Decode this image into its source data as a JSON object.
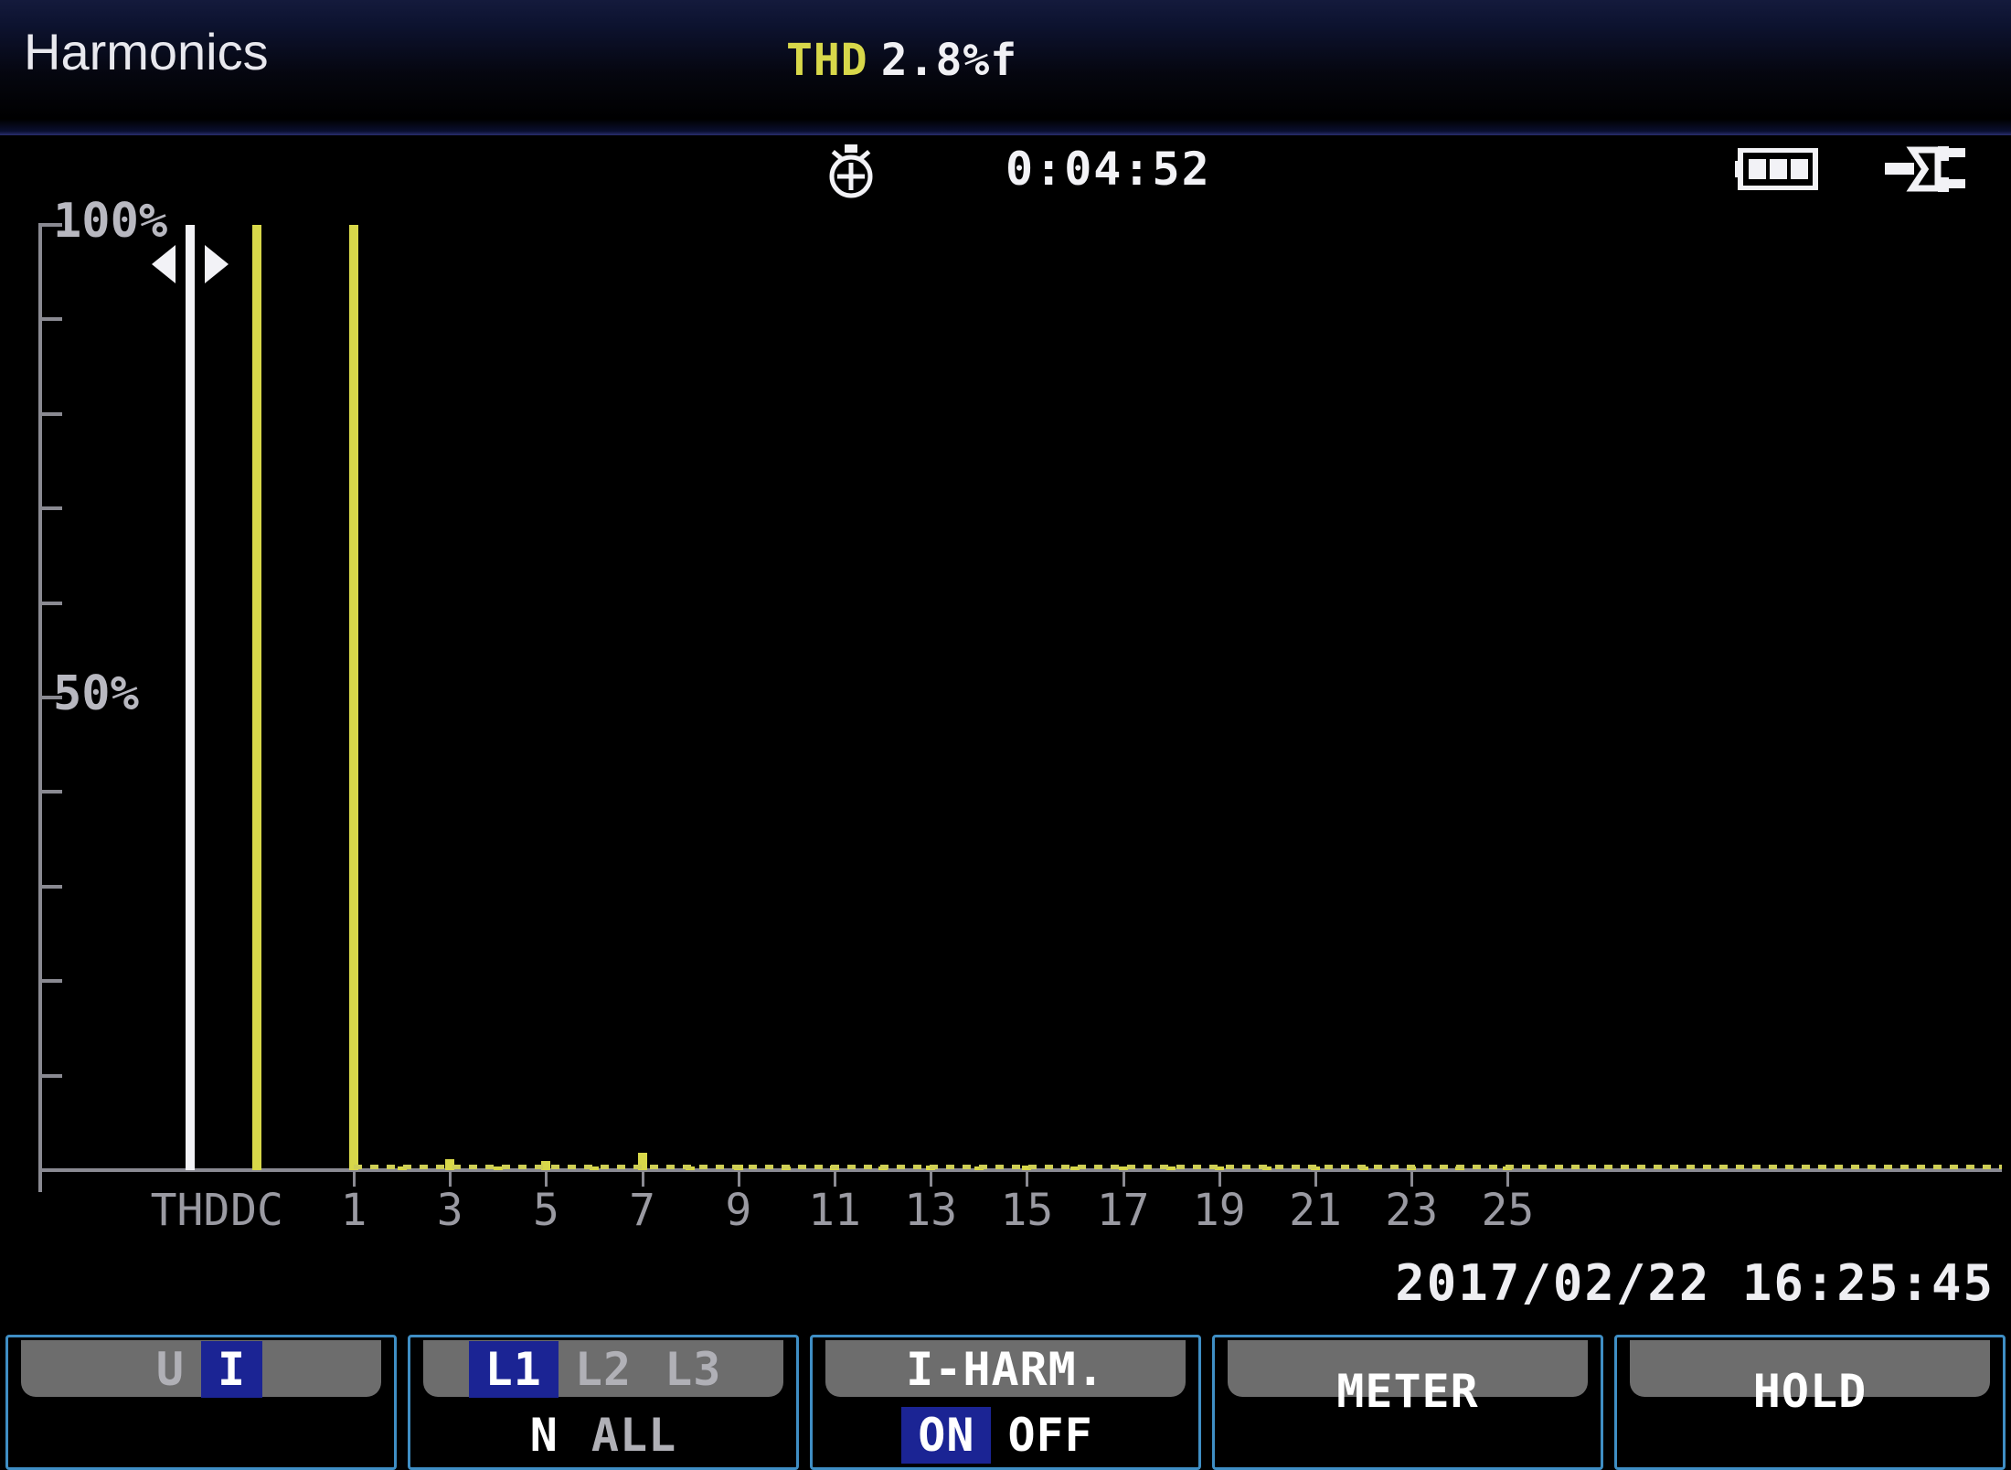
{
  "header": {
    "title": "Harmonics",
    "thd_label": "THD",
    "thd_value": "2.8%f",
    "thd_color": "#d8d84a"
  },
  "status": {
    "timer_icon": "stopwatch-icon",
    "timer": "0:04:52",
    "battery_icon": "battery-full-icon",
    "battery_bars": 3,
    "power_icon": "power-plug-icon"
  },
  "chart_data": {
    "type": "bar",
    "title": "Harmonics",
    "xlabel": "",
    "ylabel": "%",
    "ylim": [
      0,
      110
    ],
    "grid": false,
    "legend": "none",
    "ytick_labels": [
      "100%",
      "50%"
    ],
    "ytick_values": [
      100,
      50
    ],
    "yticks_minor": [
      90,
      80,
      70,
      60,
      40,
      30,
      20,
      10
    ],
    "xtick_labels": [
      "THD",
      "DC",
      "1",
      "3",
      "5",
      "7",
      "9",
      "11",
      "13",
      "15",
      "17",
      "19",
      "21",
      "23",
      "25"
    ],
    "categories": [
      "THD",
      "DC",
      "1",
      "2",
      "3",
      "4",
      "5",
      "6",
      "7",
      "8",
      "9",
      "10",
      "11",
      "12",
      "13",
      "14",
      "15",
      "16",
      "17",
      "18",
      "19",
      "20",
      "21",
      "22",
      "23",
      "24",
      "25"
    ],
    "values": [
      2.8,
      100,
      100,
      0.4,
      1.2,
      0.4,
      1.0,
      0.4,
      1.8,
      0.4,
      0.6,
      0.4,
      0.5,
      0.4,
      0.5,
      0.4,
      0.5,
      0.4,
      0.4,
      0.4,
      0.4,
      0.4,
      0.4,
      0.4,
      0.4,
      0.4,
      0.4
    ],
    "colors": [
      "#e8e8ee",
      "#d8d84a",
      "#d8d84a",
      "#d8d84a",
      "#d8d84a",
      "#d8d84a",
      "#d8d84a",
      "#d8d84a",
      "#d8d84a",
      "#d8d84a",
      "#d8d84a",
      "#d8d84a",
      "#d8d84a",
      "#d8d84a",
      "#d8d84a",
      "#d8d84a",
      "#d8d84a",
      "#d8d84a",
      "#d8d84a",
      "#d8d84a",
      "#d8d84a",
      "#d8d84a",
      "#d8d84a",
      "#d8d84a",
      "#d8d84a",
      "#d8d84a",
      "#d8d84a"
    ],
    "cursor": {
      "category": "THD",
      "value": 100,
      "color": "#f2f2f6",
      "left_arrow": "triangle-left-icon",
      "right_arrow": "triangle-right-icon"
    }
  },
  "footer": {
    "datetime": "2017/02/22  16:25:45"
  },
  "softkeys": [
    {
      "name": "uikey",
      "top_segments": [
        {
          "text": "U",
          "selected": false
        },
        {
          "text": "I",
          "selected": true
        }
      ],
      "bottom_segments": []
    },
    {
      "name": "phase",
      "top_segments": [
        {
          "text": "L1",
          "selected": true
        },
        {
          "text": "L2",
          "selected": false
        },
        {
          "text": "L3",
          "selected": false
        }
      ],
      "bottom_segments": [
        {
          "text": "N",
          "selected": false,
          "bright": true
        },
        {
          "text": "ALL",
          "selected": false,
          "bright": false
        }
      ]
    },
    {
      "name": "i-harm",
      "header": "I-HARM.",
      "top_segments": [],
      "bottom_segments": [
        {
          "text": "ON",
          "selected": true
        },
        {
          "text": "OFF",
          "selected": false,
          "bright": true
        }
      ]
    },
    {
      "name": "meter",
      "label": "METER"
    },
    {
      "name": "hold",
      "label": "HOLD"
    }
  ]
}
